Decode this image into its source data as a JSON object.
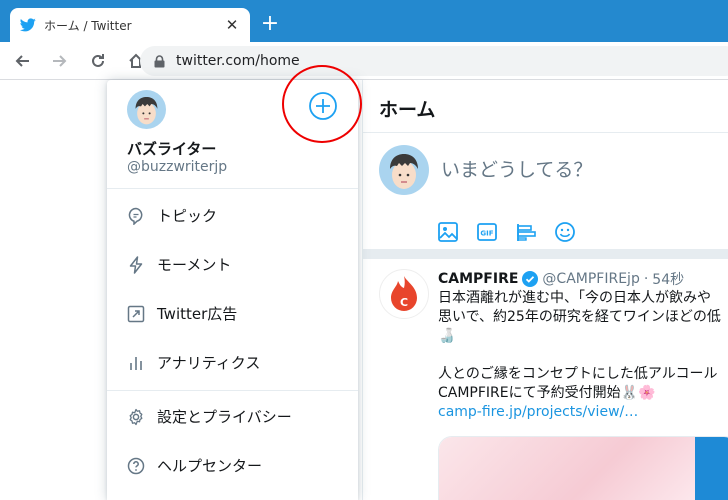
{
  "browser": {
    "tab_title": "ホーム / Twitter",
    "tab_close": "✕",
    "new_tab": "+",
    "url": "twitter.com/home"
  },
  "main": {
    "title": "ホーム",
    "compose_placeholder": "いまどうしてる？",
    "compose_icons": [
      "image-icon",
      "gif-icon",
      "poll-icon",
      "emoji-icon"
    ]
  },
  "tweet": {
    "name": "CAMPFIRE",
    "handle": "@CAMPFIREjp",
    "dot": "·",
    "time": "54秒",
    "lines": [
      "日本酒離れが進む中、「今の日本人が飲みや",
      "思いで、約25年の研究を経てワインほどの低",
      "🍶",
      "",
      "人とのご縁をコンセプトにした低アルコール",
      "CAMPFIREにて予約受付開始🐰🌸"
    ],
    "link": "camp-fire.jp/projects/view/…"
  },
  "menu": {
    "name": "バズライター",
    "handle": "@buzzwriterjp",
    "items": [
      {
        "label": "トピック",
        "icon": "topics-icon"
      },
      {
        "label": "モーメント",
        "icon": "lightning-icon"
      },
      {
        "label": "Twitter広告",
        "icon": "ads-icon"
      },
      {
        "label": "アナリティクス",
        "icon": "analytics-icon"
      },
      {
        "label": "設定とプライバシー",
        "icon": "gear-icon"
      },
      {
        "label": "ヘルプセンター",
        "icon": "help-icon"
      }
    ]
  },
  "colors": {
    "accent": "#1da1f2",
    "chrome": "#2489cf",
    "highlight": "#e00000"
  }
}
